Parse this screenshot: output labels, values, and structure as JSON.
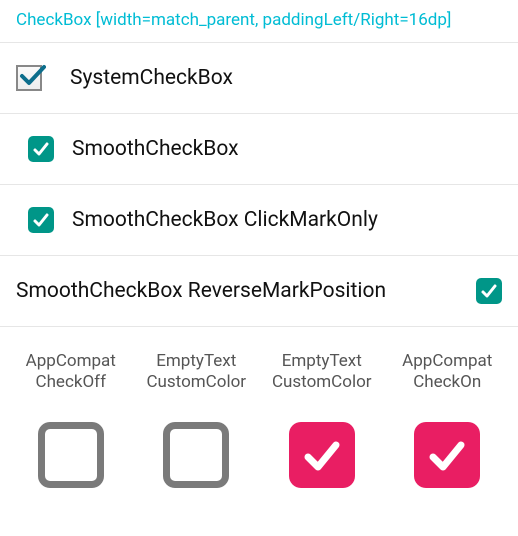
{
  "header": {
    "text": "CheckBox [width=match_parent, paddingLeft/Right=16dp]"
  },
  "rows": {
    "system": {
      "label": "SystemCheckBox"
    },
    "smooth": {
      "label": "SmoothCheckBox"
    },
    "smooth_clickmark": {
      "label": "SmoothCheckBox ClickMarkOnly"
    },
    "smooth_reverse": {
      "label": "SmoothCheckBox ReverseMarkPosition"
    }
  },
  "grid": {
    "labels": {
      "col0_line1": "AppCompat",
      "col0_line2": "CheckOff",
      "col1_line1": "EmptyText",
      "col1_line2": "CustomColor",
      "col2_line1": "EmptyText",
      "col2_line2": "CustomColor",
      "col3_line1": "AppCompat",
      "col3_line2": "CheckOn"
    }
  },
  "colors": {
    "accent_teal": "#00bcd4",
    "smooth_green": "#009688",
    "big_pink": "#e91e63",
    "big_off_border": "#7a7a7a"
  }
}
